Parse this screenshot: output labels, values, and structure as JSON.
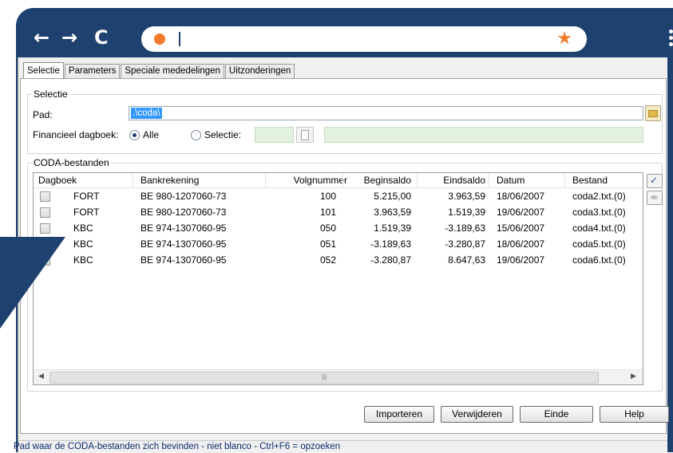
{
  "browser": {
    "back_icon": "back-arrow-icon",
    "forward_icon": "forward-arrow-icon",
    "reload_icon": "reload-icon",
    "back_glyph": "←",
    "forward_glyph": "→",
    "reload_glyph": "C",
    "star_glyph": "★",
    "accent_color": "#f07c2c",
    "frame_color": "#1e4170"
  },
  "tabs": [
    {
      "label": "Selectie",
      "active": true
    },
    {
      "label": "Parameters",
      "active": false
    },
    {
      "label": "Speciale mededelingen",
      "active": false
    },
    {
      "label": "Uitzonderingen",
      "active": false
    }
  ],
  "selectie": {
    "group_title": "Selectie",
    "pad_label": "Pad:",
    "pad_value": ".\\coda\\",
    "dagboek_label": "Financieel dagboek:",
    "radio_alle": "Alle",
    "radio_selectie": "Selectie:"
  },
  "coda": {
    "group_title": "CODA-bestanden",
    "columns": [
      "Dagboek",
      "Bankrekening",
      "Volgnummer",
      "Beginsaldo",
      "Eindsaldo",
      "Datum",
      "Bestand"
    ],
    "rows": [
      {
        "dagboek": "FORT",
        "bank": "BE 980-1207060-73",
        "volg": "100",
        "begin": "5.215,00",
        "eind": "3.963,59",
        "datum": "18/06/2007",
        "bestand": "coda2.txt.(0)"
      },
      {
        "dagboek": "FORT",
        "bank": "BE 980-1207060-73",
        "volg": "101",
        "begin": "3.963,59",
        "eind": "1.519,39",
        "datum": "19/06/2007",
        "bestand": "coda3.txt.(0)"
      },
      {
        "dagboek": "KBC",
        "bank": "BE 974-1307060-95",
        "volg": "050",
        "begin": "1.519,39",
        "eind": "-3.189,63",
        "datum": "15/06/2007",
        "bestand": "coda4.txt.(0)"
      },
      {
        "dagboek": "KBC",
        "bank": "BE 974-1307060-95",
        "volg": "051",
        "begin": "-3.189,63",
        "eind": "-3.280,87",
        "datum": "18/06/2007",
        "bestand": "coda5.txt.(0)"
      },
      {
        "dagboek": "KBC",
        "bank": "BE 974-1307060-95",
        "volg": "052",
        "begin": "-3.280,87",
        "eind": "8.647,63",
        "datum": "19/06/2007",
        "bestand": "coda6.txt.(0)"
      }
    ]
  },
  "buttons": {
    "importeren": "Importeren",
    "verwijderen": "Verwijderen",
    "einde": "Einde",
    "help": "Help"
  },
  "status_text": "Pad waar de CODA-bestanden zich bevinden - niet blanco - Ctrl+F6 = opzoeken"
}
